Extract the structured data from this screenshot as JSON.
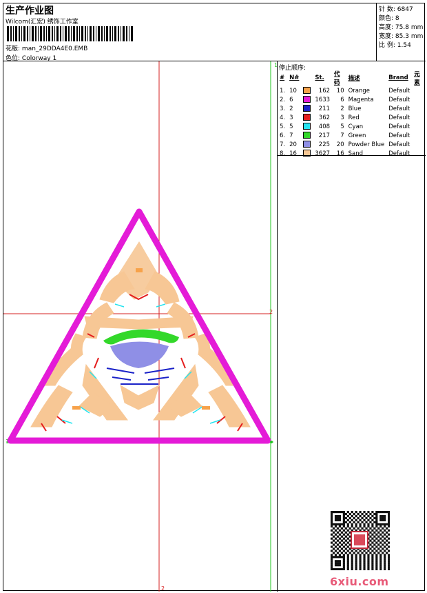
{
  "header": {
    "title": "生产作业图",
    "subtitle": "Wilcom(汇宏) 绣饰工作室",
    "file_label": "花版:",
    "file_name": "man_29DDA4E0.EMB",
    "colorway_label": "色位:",
    "colorway_value": "Colorway 1"
  },
  "stats": [
    {
      "label": "针 数:",
      "value": "6847"
    },
    {
      "label": "颜色:",
      "value": "8"
    },
    {
      "label": "高度:",
      "value": "75.8 mm"
    },
    {
      "label": "宽度:",
      "value": "85.3 mm"
    },
    {
      "label": "比 例:",
      "value": "1.54"
    }
  ],
  "sequence": {
    "title": "停止顺序:",
    "columns": [
      "#",
      "N#",
      "St.",
      "代码",
      "描述",
      "Brand",
      "元素"
    ],
    "rows": [
      {
        "idx": "1.",
        "n": "10",
        "color": "#f7a24a",
        "st": "162",
        "code": "10",
        "desc": "Orange",
        "brand": "Default"
      },
      {
        "idx": "2.",
        "n": "6",
        "color": "#e41bd7",
        "st": "1633",
        "code": "6",
        "desc": "Magenta",
        "brand": "Default"
      },
      {
        "idx": "3.",
        "n": "2",
        "color": "#1a22c8",
        "st": "211",
        "code": "2",
        "desc": "Blue",
        "brand": "Default"
      },
      {
        "idx": "4.",
        "n": "3",
        "color": "#e41d1d",
        "st": "362",
        "code": "3",
        "desc": "Red",
        "brand": "Default"
      },
      {
        "idx": "5.",
        "n": "5",
        "color": "#25e4f0",
        "st": "408",
        "code": "5",
        "desc": "Cyan",
        "brand": "Default"
      },
      {
        "idx": "6.",
        "n": "7",
        "color": "#33d82a",
        "st": "217",
        "code": "7",
        "desc": "Green",
        "brand": "Default"
      },
      {
        "idx": "7.",
        "n": "20",
        "color": "#8f8fe6",
        "st": "225",
        "code": "20",
        "desc": "Powder Blue",
        "brand": "Default"
      },
      {
        "idx": "8.",
        "n": "16",
        "color": "#f7c795",
        "st": "3627",
        "code": "16",
        "desc": "Sand",
        "brand": "Default"
      }
    ]
  },
  "guides": {
    "v_label": "1",
    "h_label": "2",
    "bottom_label": "2",
    "left_label": "1"
  },
  "watermark": "6xiu.com",
  "colors": {
    "guide_red": "#d62020",
    "guide_green": "#22c422"
  }
}
